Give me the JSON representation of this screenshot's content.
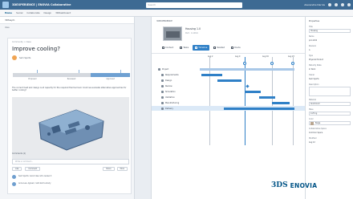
{
  "topbar": {
    "app_name": "3DEXPERIENCE | ENOVIA Collaborative",
    "search_placeholder": "Search",
    "user": "Alexandre Darnis"
  },
  "subbar": {
    "items": [
      "Home",
      "Social",
      "Collaborate",
      "Design",
      "3DDashboard"
    ]
  },
  "left": {
    "header": "3DSwym",
    "sub": "Idea",
    "post": {
      "meta": "Community > Ideas",
      "title": "Improve cooling?",
      "author": "Sam Sports",
      "maturity": [
        "Proposed",
        "Reviewed",
        "Approved"
      ],
      "body": "The current heat sink design is at capacity for the required thermal load. Could we evaluate alternative approaches for better cooling?",
      "comment_label": "Comments (1)",
      "comment_placeholder": "Write a comment...",
      "actions": [
        "Like",
        "Comment"
      ],
      "actions_right": [
        "Share",
        "More"
      ],
      "comments": [
        "Sam Sports: Good idea, let's review it",
        "Anna Lee: Agreed, I will start a study"
      ]
    }
  },
  "center": {
    "tab_label": "3DEXPERIENCE",
    "object_title": "Housing 1.0",
    "object_sub": "Part · In Work",
    "tabs": [
      "Content",
      "Tasks",
      "Timeline",
      "Related",
      "Route"
    ],
    "active_tab": "Timeline",
    "dates": [
      "Aug 2",
      "Aug 9",
      "Aug 16",
      "Aug 23"
    ],
    "rows": [
      "Project",
      "Requirements",
      "Design",
      "Review",
      "Simulation",
      "Validation",
      "Manufacturing",
      "Delivery"
    ]
  },
  "right": {
    "header": "Properties",
    "fields": [
      {
        "label": "Title",
        "value": "Housing"
      },
      {
        "label": "Name",
        "value": "prd-1234"
      },
      {
        "label": "Revision",
        "value": "A"
      },
      {
        "label": "Type",
        "value": "Physical Product"
      },
      {
        "label": "Maturity State",
        "value": "In Work"
      },
      {
        "label": "Owner",
        "value": "Sam Sports"
      },
      {
        "label": "Description",
        "value": ""
      },
      {
        "label": "Material",
        "value": "Aluminium"
      },
      {
        "label": "Mass",
        "value": "0.25 kg"
      },
      {
        "label": "Color",
        "value": "Beige"
      },
      {
        "label": "Collaborative Space",
        "value": "Common Space"
      },
      {
        "label": "Modified",
        "value": "Aug 12"
      }
    ]
  },
  "brand": {
    "mark": "3DS",
    "name": "ENOVIA",
    "color": "#005386"
  }
}
